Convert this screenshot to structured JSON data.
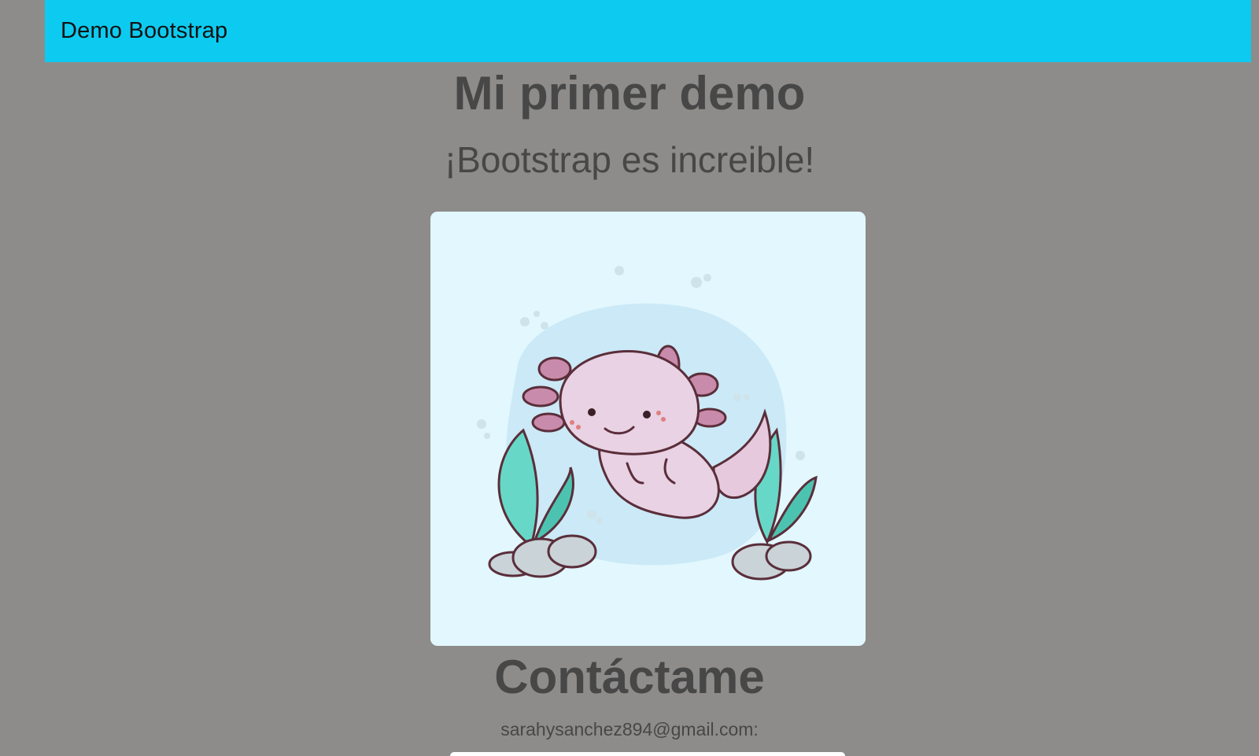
{
  "navbar": {
    "brand": "Demo Bootstrap",
    "color": "#0dcaf0"
  },
  "hero": {
    "title": "Mi primer demo",
    "subtitle": "¡Bootstrap es increible!"
  },
  "image": {
    "subject": "axolotl-illustration"
  },
  "contact": {
    "title": "Contáctame",
    "email_label": "sarahysanchez894@gmail.com:"
  },
  "colors": {
    "background": "#8d8c8b",
    "text": "#474747",
    "image_background": "#e2f7fe"
  }
}
